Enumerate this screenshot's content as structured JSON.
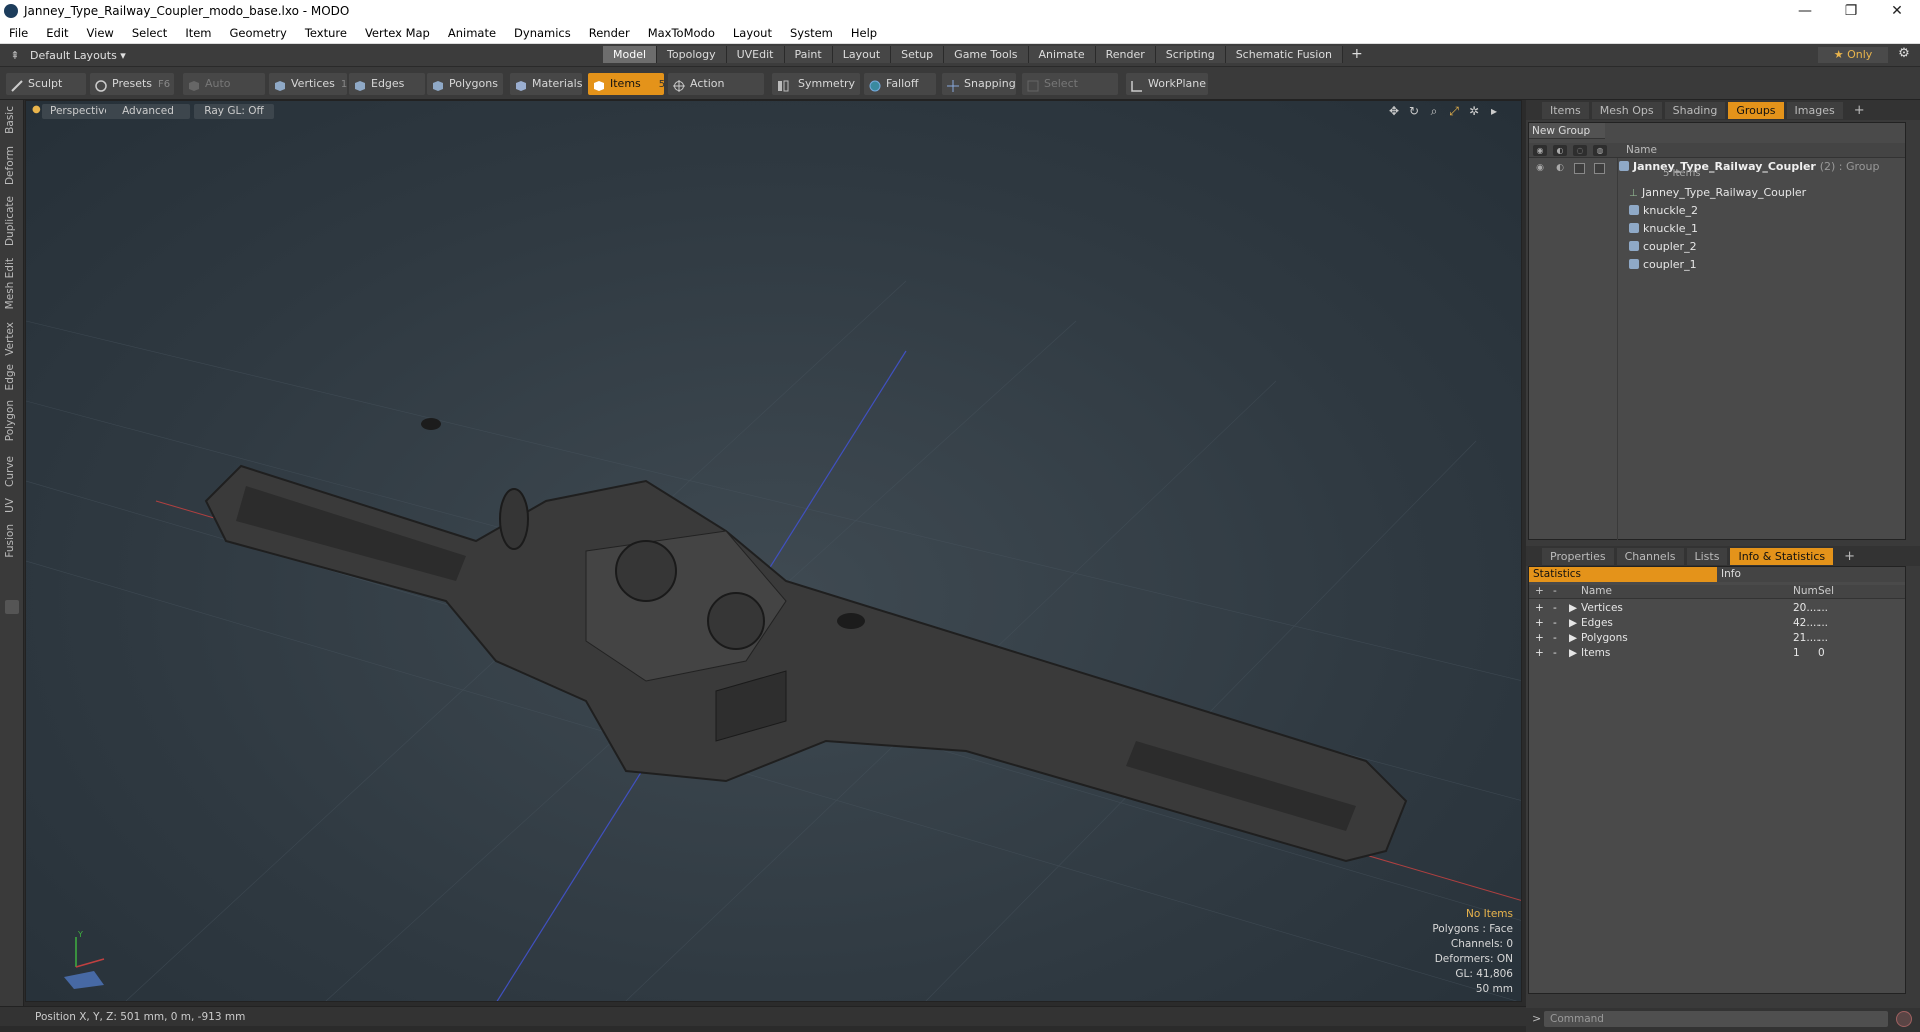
{
  "window": {
    "title": "Janney_Type_Railway_Coupler_modo_base.lxo - MODO",
    "minimize": "—",
    "maximize": "❐",
    "close": "✕"
  },
  "menu": [
    "File",
    "Edit",
    "View",
    "Select",
    "Item",
    "Geometry",
    "Texture",
    "Vertex Map",
    "Animate",
    "Dynamics",
    "Render",
    "MaxToModo",
    "Layout",
    "System",
    "Help"
  ],
  "layoutbar": {
    "layout_select": "Default Layouts ▾",
    "tabs": [
      "Model",
      "Topology",
      "UVEdit",
      "Paint",
      "Layout",
      "Setup",
      "Game Tools",
      "Animate",
      "Render",
      "Scripting",
      "Schematic Fusion"
    ],
    "active_tab": "Model",
    "only_label": "★  Only"
  },
  "toolbar": {
    "sculpt": "Sculpt",
    "presets": "Presets",
    "presets_key": "F6",
    "auto_select": "Auto Select",
    "vertices": "Vertices",
    "vertices_key": "1",
    "edges": "Edges",
    "edges_key": "2",
    "polygons": "Polygons",
    "materials": "Materials",
    "items": "Items",
    "items_key": "5",
    "action_center": "Action Center",
    "symmetry": "Symmetry",
    "falloff": "Falloff",
    "snapping": "Snapping",
    "select_through": "Select Through",
    "workplane": "WorkPlane"
  },
  "left_tabs": [
    "Basic",
    "Deform",
    "Duplicate",
    "Mesh Edit",
    "Vertex",
    "Edge",
    "Polygon",
    "Curve",
    "UV",
    "Fusion"
  ],
  "viewport": {
    "view_mode": "Perspective",
    "shading": "Advanced",
    "raygl": "Ray GL: Off",
    "info": {
      "items": "No Items",
      "polygons": "Polygons : Face",
      "channels": "Channels: 0",
      "deformers": "Deformers: ON",
      "gl": "GL: 41,806",
      "scale": "50 mm"
    }
  },
  "status": {
    "position": "Position X, Y, Z:   501 mm, 0 m, -913 mm"
  },
  "right_top_tabs": [
    "Items",
    "Mesh Ops",
    "Shading",
    "Groups",
    "Images"
  ],
  "right_top_active": "Groups",
  "groups": {
    "new_group": "New Group",
    "name_header": "Name",
    "group_name": "Janney_Type_Railway_Coupler",
    "group_suffix": "(2) : Group",
    "group_sub": "5 Items",
    "children": [
      {
        "name": "Janney_Type_Railway_Coupler",
        "kind": "locator"
      },
      {
        "name": "knuckle_2",
        "kind": "mesh"
      },
      {
        "name": "knuckle_1",
        "kind": "mesh"
      },
      {
        "name": "coupler_2",
        "kind": "mesh"
      },
      {
        "name": "coupler_1",
        "kind": "mesh"
      }
    ]
  },
  "right_bottom_tabs": [
    "Properties",
    "Channels",
    "Lists",
    "Info & Statistics"
  ],
  "right_bottom_active": "Info & Statistics",
  "stats": {
    "tab_statistics": "Statistics",
    "tab_info": "Info",
    "headers": {
      "name": "Name",
      "num": "Num",
      "sel": "Sel"
    },
    "rows": [
      {
        "name": "Vertices",
        "num": "20....",
        "sel": "..."
      },
      {
        "name": "Edges",
        "num": "42....",
        "sel": "..."
      },
      {
        "name": "Polygons",
        "num": "21....",
        "sel": "..."
      },
      {
        "name": "Items",
        "num": "1",
        "sel": "0"
      }
    ]
  },
  "command": {
    "prompt": ">",
    "placeholder": "Command"
  },
  "colors": {
    "accent": "#e4931a",
    "highlight_text": "#e9b44c"
  }
}
